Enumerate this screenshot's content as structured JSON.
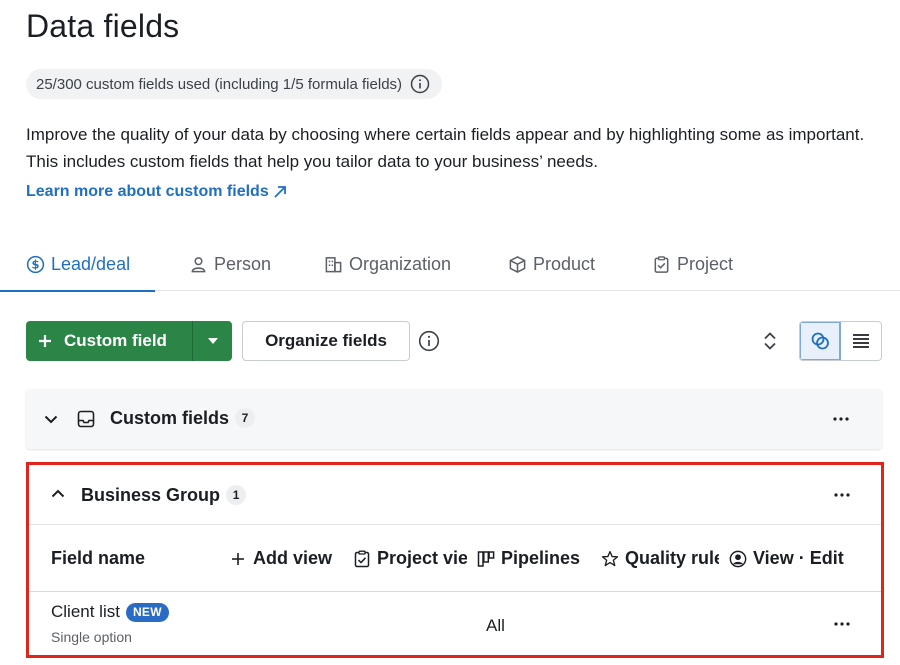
{
  "page": {
    "title": "Data fields",
    "usage": "25/300 custom fields used (including 1/5 formula fields)",
    "description": "Improve the quality of your data by choosing where certain fields appear and by highlighting some as important. This includes custom fields that help you tailor data to your business’ needs.",
    "learn_more": "Learn more about custom fields"
  },
  "tabs": [
    {
      "label": "Lead/deal",
      "icon": "dollar-circle-icon",
      "active": true
    },
    {
      "label": "Person",
      "icon": "person-icon"
    },
    {
      "label": "Organization",
      "icon": "building-icon"
    },
    {
      "label": "Product",
      "icon": "box-icon"
    },
    {
      "label": "Project",
      "icon": "clipboard-icon"
    }
  ],
  "toolbar": {
    "custom_field_label": "Custom field",
    "organize_label": "Organize fields"
  },
  "groups": [
    {
      "title": "Custom fields",
      "count": "7",
      "expanded": false
    },
    {
      "title": "Business Group",
      "count": "1",
      "expanded": true
    }
  ],
  "columns": {
    "field_name": "Field name",
    "add_view": "Add view",
    "project_view": "Project view",
    "pipelines": "Pipelines",
    "quality_rules": "Quality rules",
    "view_edit": "View · Edit"
  },
  "rows": [
    {
      "name": "Client list",
      "badge": "NEW",
      "type": "Single option",
      "pipelines": "All"
    }
  ],
  "colors": {
    "accent": "#1f6fc2",
    "primary_button": "#2a8547",
    "highlight_border": "#e1251b",
    "new_badge": "#2a6cc4"
  }
}
